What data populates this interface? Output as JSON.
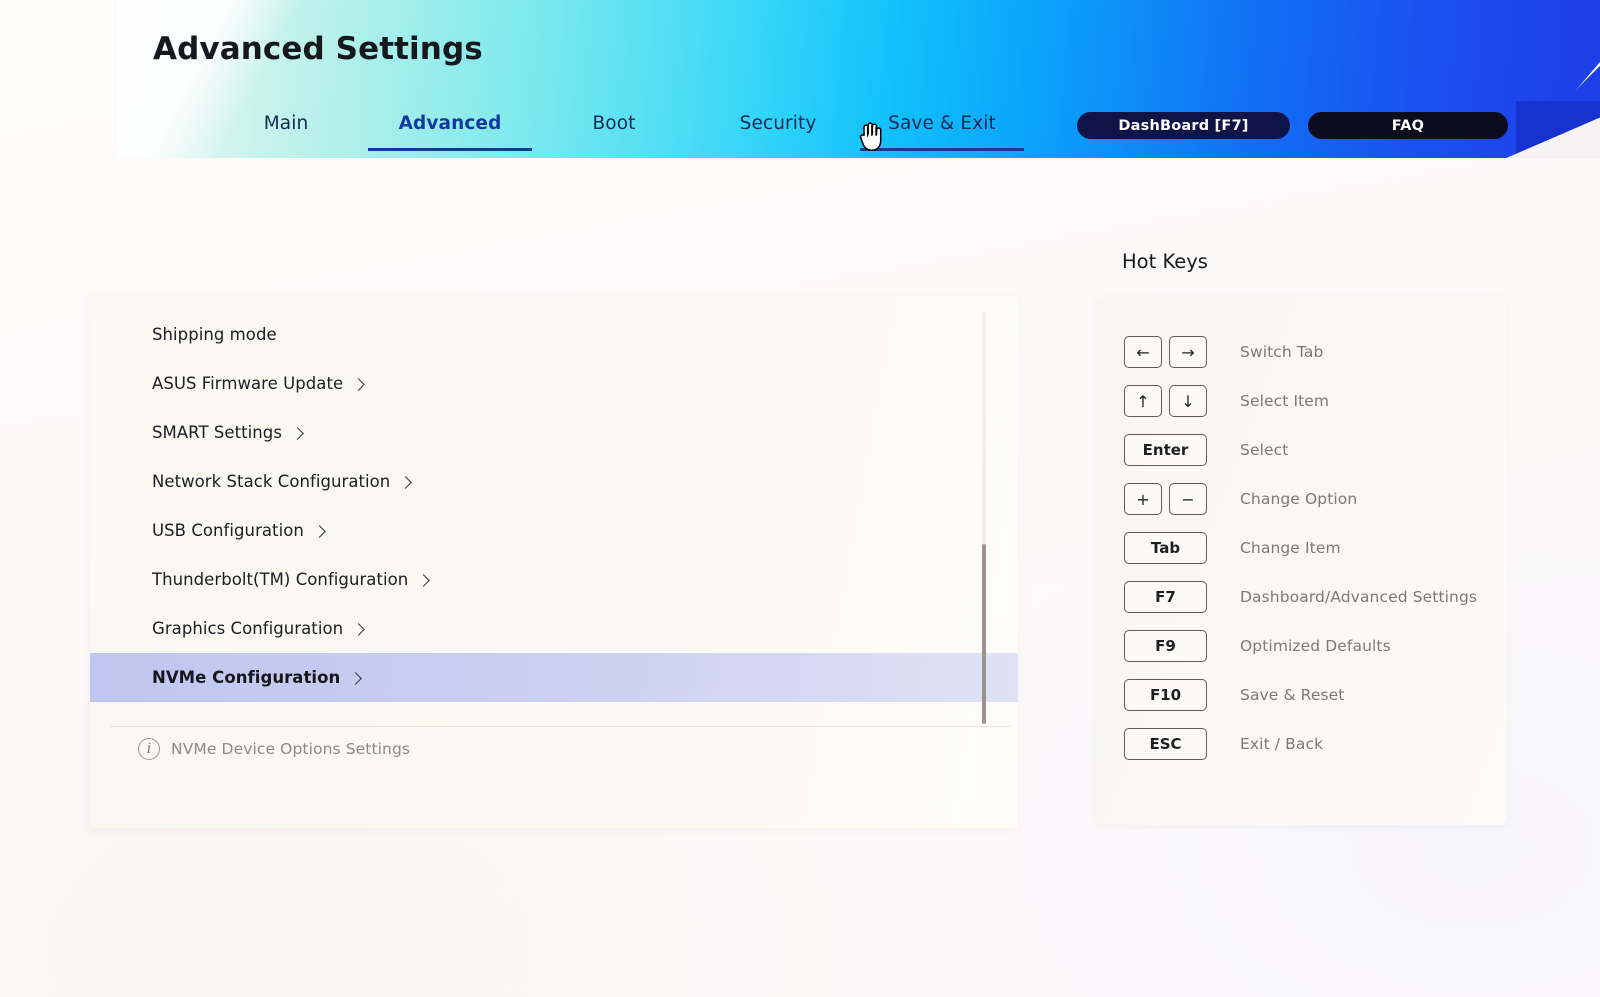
{
  "app": {
    "title": "Advanced Settings"
  },
  "header": {
    "tabs": [
      {
        "label": "Main",
        "active": false
      },
      {
        "label": "Advanced",
        "active": true
      },
      {
        "label": "Boot",
        "active": false
      },
      {
        "label": "Security",
        "active": false
      },
      {
        "label": "Save & Exit",
        "active": false
      }
    ],
    "buttons": {
      "dashboard": "DashBoard [F7]",
      "faq": "FAQ"
    },
    "cursor_icon": "hand-pointer-cursor",
    "gradient_from": "#e8f7f2",
    "gradient_mid": "#11c2fb",
    "gradient_to": "#1f3ee8"
  },
  "main": {
    "menu_items": [
      {
        "label": "Shipping mode",
        "has_submenu": false,
        "selected": false
      },
      {
        "label": "ASUS Firmware Update",
        "has_submenu": true,
        "selected": false
      },
      {
        "label": "SMART Settings",
        "has_submenu": true,
        "selected": false
      },
      {
        "label": "Network Stack Configuration",
        "has_submenu": true,
        "selected": false
      },
      {
        "label": "USB Configuration",
        "has_submenu": true,
        "selected": false
      },
      {
        "label": "Thunderbolt(TM) Configuration",
        "has_submenu": true,
        "selected": false
      },
      {
        "label": "Graphics Configuration",
        "has_submenu": true,
        "selected": false
      },
      {
        "label": "NVMe Configuration",
        "has_submenu": true,
        "selected": true
      }
    ],
    "info": {
      "icon": "info-circle-icon",
      "text": "NVMe Device Options Settings"
    },
    "selection_color": "#c5cbf0"
  },
  "hotkeys": {
    "title": "Hot Keys",
    "rows": [
      {
        "keys": [
          "←",
          "→"
        ],
        "desc": "Switch Tab",
        "style": "arrow"
      },
      {
        "keys": [
          "↑",
          "↓"
        ],
        "desc": "Select Item",
        "style": "arrow"
      },
      {
        "keys": [
          "Enter"
        ],
        "desc": "Select",
        "style": "wide"
      },
      {
        "keys": [
          "+",
          "−"
        ],
        "desc": "Change Option",
        "style": "arrow"
      },
      {
        "keys": [
          "Tab"
        ],
        "desc": "Change Item",
        "style": "wide"
      },
      {
        "keys": [
          "F7"
        ],
        "desc": "Dashboard/Advanced Settings",
        "style": "wide"
      },
      {
        "keys": [
          "F9"
        ],
        "desc": "Optimized Defaults",
        "style": "wide"
      },
      {
        "keys": [
          "F10"
        ],
        "desc": "Save & Reset",
        "style": "wide"
      },
      {
        "keys": [
          "ESC"
        ],
        "desc": "Exit / Back",
        "style": "wide"
      }
    ]
  }
}
